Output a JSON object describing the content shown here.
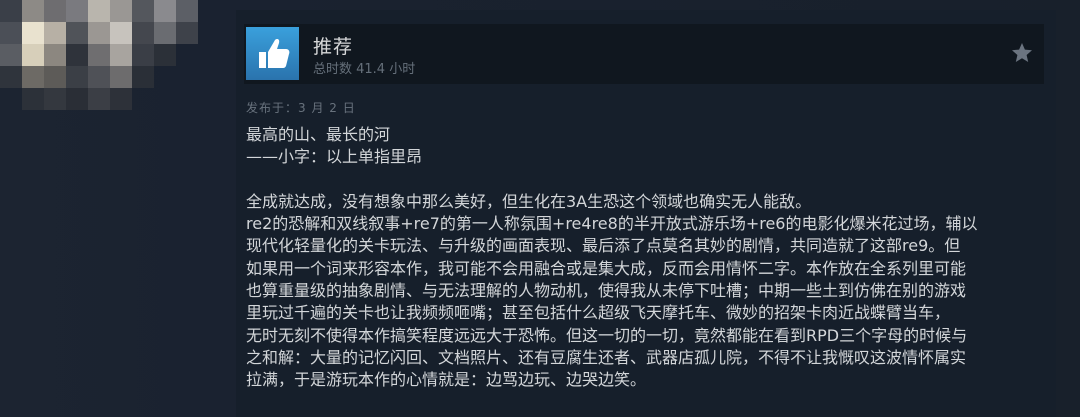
{
  "review": {
    "vote_label": "推荐",
    "hours_text": "总时数 41.4 小时",
    "posted_text": "发布于：3 月 2 日",
    "title_lines": [
      "最高的山、最长的河",
      "——小字：以上单指里昂"
    ],
    "body_lines": [
      "全成就达成，没有想象中那么美好，但生化在3A生恐这个领域也确实无人能敌。",
      "re2的恐解和双线叙事+re7的第一人称氛围+re4re8的半开放式游乐场+re6的电影化爆米花过场，辅以",
      "现代化轻量化的关卡玩法、与升级的画面表现、最后添了点莫名其妙的剧情，共同造就了这部re9。但",
      "如果用一个词来形容本作，我可能不会用融合或是集大成，反而会用情怀二字。本作放在全系列里可能",
      "也算重量级的抽象剧情、与无法理解的人物动机，使得我从未停下吐槽；中期一些土到仿佛在别的游戏",
      "里玩过千遍的关卡也让我频频咂嘴；甚至包括什么超级飞天摩托车、微妙的招架卡肉近战蝶臂当车，",
      "无时无刻不使得本作搞笑程度远远大于恐怖。但这一切的一切，竟然都能在看到RPD三个字母的时候与",
      "之和解：大量的记忆闪回、文档照片、还有豆腐生还者、武器店孤儿院，不得不让我慨叹这波情怀属实",
      "拉满，于是游玩本作的心情就是：边骂边玩、边哭边笑。"
    ]
  },
  "colors": {
    "thumb_bg": "#3aa0dc",
    "text": "#d3d6d9",
    "muted": "#656f7a"
  }
}
